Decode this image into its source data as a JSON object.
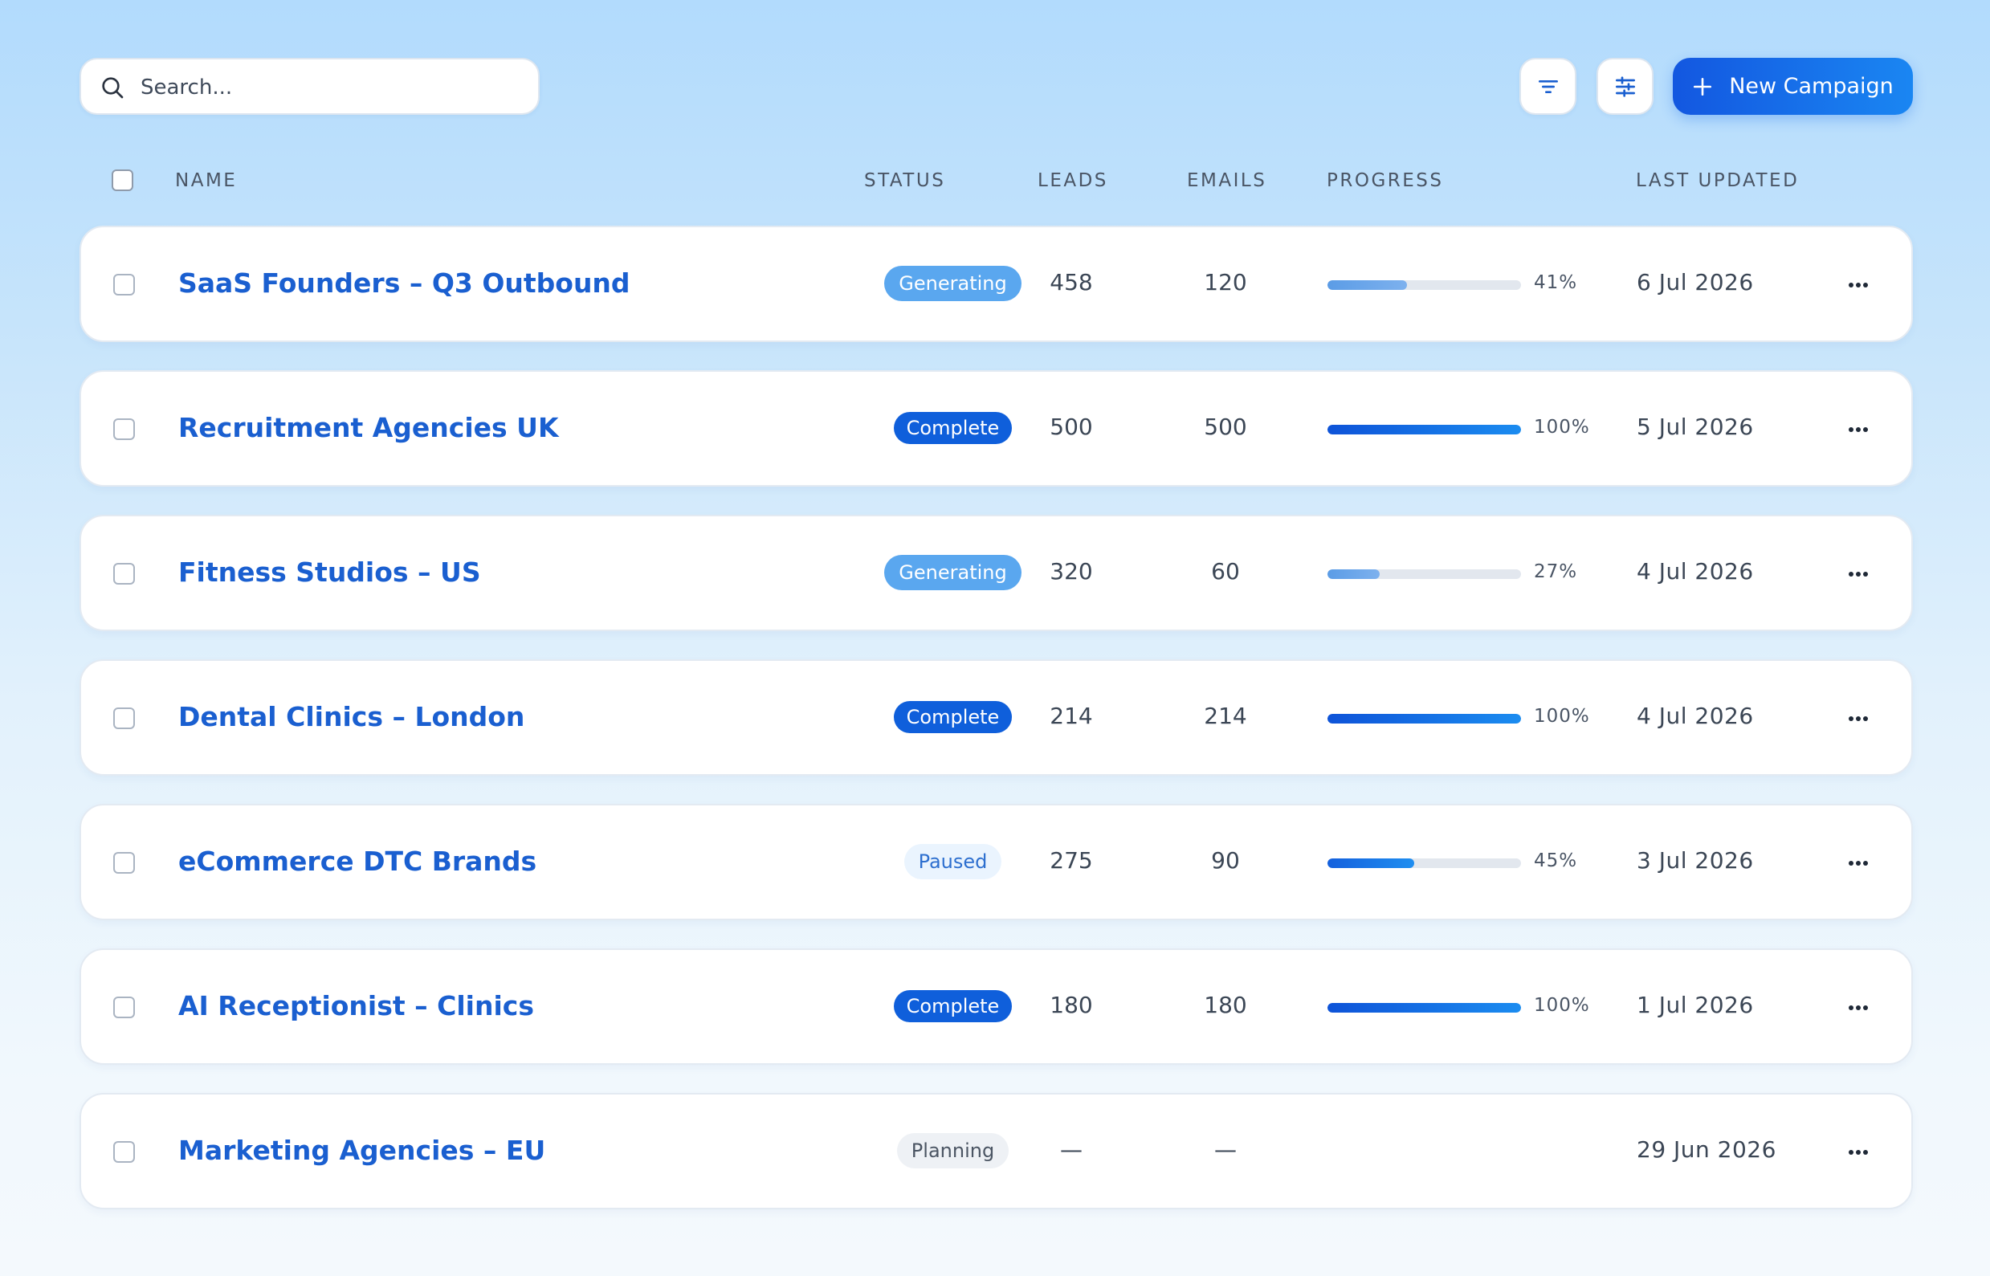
{
  "search": {
    "placeholder": "Search..."
  },
  "toolbar": {
    "filter_icon": "filter-lines-icon",
    "adjust_icon": "sliders-icon",
    "new_campaign_label": "New Campaign",
    "accent": "#1a6ee8"
  },
  "table": {
    "headers": {
      "name": "NAME",
      "status": "STATUS",
      "leads": "LEADS",
      "emails": "EMAILS",
      "progress": "PROGRESS",
      "last_updated": "LAST UPDATED"
    },
    "rows": [
      {
        "name": "SaaS Founders – Q3 Outbound",
        "status": "Generating",
        "status_kind": "generating",
        "leads": "458",
        "emails": "120",
        "progress": 41,
        "progress_label": "41%",
        "updated": "6 Jul 2026"
      },
      {
        "name": "Recruitment Agencies UK",
        "status": "Complete",
        "status_kind": "complete",
        "leads": "500",
        "emails": "500",
        "progress": 100,
        "progress_label": "100%",
        "updated": "5 Jul 2026"
      },
      {
        "name": "Fitness Studios – US",
        "status": "Generating",
        "status_kind": "generating",
        "leads": "320",
        "emails": "60",
        "progress": 27,
        "progress_label": "27%",
        "updated": "4 Jul 2026"
      },
      {
        "name": "Dental Clinics – London",
        "status": "Complete",
        "status_kind": "complete",
        "leads": "214",
        "emails": "214",
        "progress": 100,
        "progress_label": "100%",
        "updated": "4 Jul 2026"
      },
      {
        "name": "eCommerce DTC Brands",
        "status": "Paused",
        "status_kind": "paused",
        "leads": "275",
        "emails": "90",
        "progress": 45,
        "progress_label": "45%",
        "updated": "3 Jul 2026"
      },
      {
        "name": "AI Receptionist – Clinics",
        "status": "Complete",
        "status_kind": "complete",
        "leads": "180",
        "emails": "180",
        "progress": 100,
        "progress_label": "100%",
        "updated": "1 Jul 2026"
      },
      {
        "name": "Marketing Agencies – EU",
        "status": "Planning",
        "status_kind": "planning",
        "leads": "—",
        "emails": "—",
        "progress": null,
        "progress_label": "",
        "updated": "29 Jun 2026"
      }
    ]
  }
}
